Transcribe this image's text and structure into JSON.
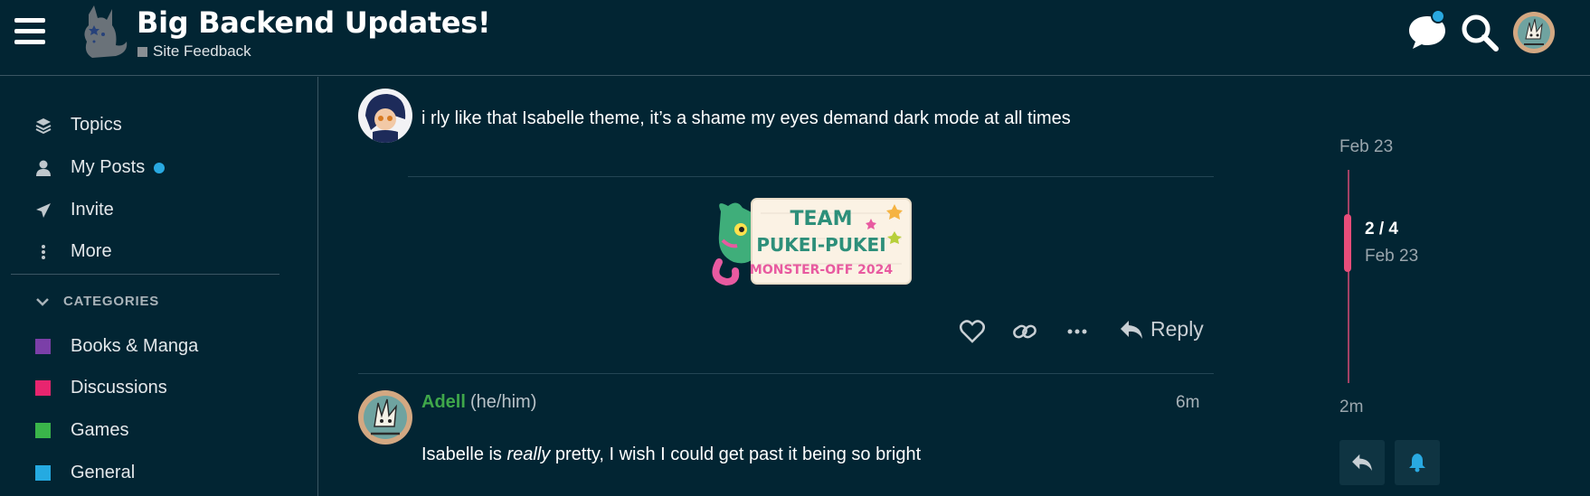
{
  "header": {
    "title": "Big Backend Updates!",
    "category": "Site Feedback",
    "category_color": "#8a8f94",
    "notification_color": "#29a9e1"
  },
  "sidebar": {
    "items": [
      {
        "label": "Topics",
        "icon": "layers-icon"
      },
      {
        "label": "My Posts",
        "icon": "user-icon"
      },
      {
        "label": "Invite",
        "icon": "paper-plane-icon"
      },
      {
        "label": "More",
        "icon": "vertical-ellipsis-icon"
      }
    ],
    "categories_heading": "CATEGORIES",
    "categories": [
      {
        "label": "Books & Manga",
        "color": "#7b3fa8"
      },
      {
        "label": "Discussions",
        "color": "#e8256f"
      },
      {
        "label": "Games",
        "color": "#3ab54a"
      },
      {
        "label": "General",
        "color": "#25aae1"
      }
    ]
  },
  "posts": [
    {
      "text": "i rly like that Isabelle theme, it’s a shame my eyes demand dark mode at all times",
      "sticker": {
        "line1": "TEAM",
        "line2": "PUKEI-PUKEI",
        "line3": "MONSTER-OFF 2024"
      },
      "actions": {
        "reply_label": "Reply"
      }
    },
    {
      "username": "Adell",
      "pronouns": "(he/him)",
      "time": "6m",
      "text_before": "Isabelle is ",
      "text_emphasis": "really",
      "text_after": " pretty, I wish I could get past it being so bright"
    }
  ],
  "timeline": {
    "top_date": "Feb 23",
    "position": "2 / 4",
    "position_date": "Feb 23",
    "bottom_date": "2m",
    "accent": "#e84d7a"
  }
}
